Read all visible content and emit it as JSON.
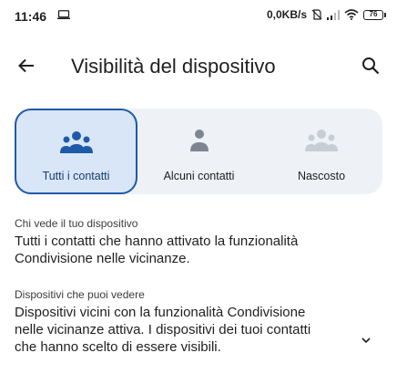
{
  "status_bar": {
    "time": "11:46",
    "network_speed": "0,0KB/s",
    "battery_level": "76",
    "icons": [
      "screen-icon",
      "no-sim-icon",
      "signal-icon",
      "wifi-icon",
      "battery-icon"
    ]
  },
  "app_bar": {
    "title": "Visibilità del dispositivo",
    "back_icon": "arrow-back-icon",
    "search_icon": "search-icon"
  },
  "visibility_options": {
    "selected": "Tutti i contatti",
    "items": [
      {
        "label": "Tutti i contatti",
        "icon": "people-group-icon",
        "selected": true
      },
      {
        "label": "Alcuni contatti",
        "icon": "person-icon",
        "selected": false
      },
      {
        "label": "Nascosto",
        "icon": "people-hidden-icon",
        "selected": false
      }
    ]
  },
  "who_sees": {
    "caption": "Chi vede il tuo dispositivo",
    "line1": "Tutti i contatti che hanno attivato la funzionalità",
    "line2": "Condivisione nelle vicinanze."
  },
  "visible_devices": {
    "caption": "Dispositivi che puoi vedere",
    "line1": "Dispositivi vicini con la funzionalità Condivisione",
    "line2": "nelle vicinanze attiva. I dispositivi dei tuoi contatti",
    "line3": "che hanno scelto di essere visibili.",
    "expand_icon": "chevron-down-icon"
  },
  "colors": {
    "accent": "#1f5aa8",
    "selected_bg": "#d9e6f8",
    "panel_bg": "#eef1f6",
    "inactive_icon": "#7d8590",
    "disabled_icon": "#c8cdd4"
  }
}
